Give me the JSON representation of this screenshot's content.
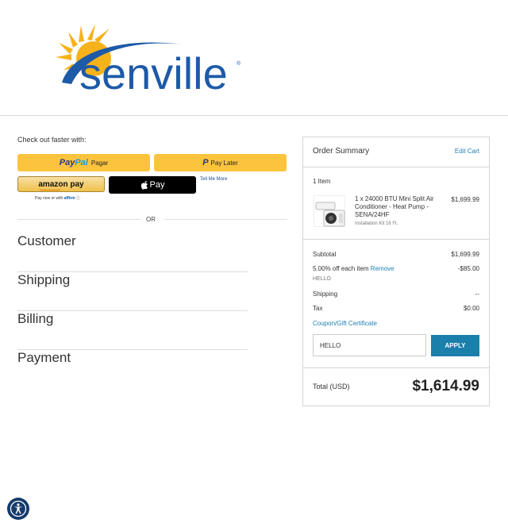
{
  "brand": {
    "logo_text": "senville",
    "logo_mark": "®",
    "colors": {
      "sun": "#f6b21a",
      "wordmark": "#1d5aa8"
    }
  },
  "express": {
    "heading": "Check out faster with:",
    "paypal_brand_a": "Pay",
    "paypal_brand_b": "Pal",
    "paypal_label": "Pagar",
    "paylater_mark": "P",
    "paylater_label": "Pay Later",
    "amazon_label": "amazon pay",
    "apple_label": "Pay",
    "tell_me_more": "Tell Me More",
    "affirm_prefix": "Pay now or with",
    "affirm_brand": "affirm",
    "or_label": "OR"
  },
  "steps": [
    "Customer",
    "Shipping",
    "Billing",
    "Payment"
  ],
  "summary": {
    "title": "Order Summary",
    "edit_cart": "Edit Cart",
    "items_count": "1 Item",
    "product": {
      "name": "1 x 24000 BTU Mini Split Air Conditioner - Heat Pump - SENA/24HF",
      "option": "Installation Kit 16 Ft.",
      "price": "$1,699.99"
    },
    "subtotal_label": "Subtotal",
    "subtotal_value": "$1,699.99",
    "discount_label": "5.00% off each item",
    "discount_remove": "Remove",
    "discount_value": "-$85.00",
    "discount_code": "HELLO",
    "shipping_label": "Shipping",
    "shipping_value": "--",
    "tax_label": "Tax",
    "tax_value": "$0.00",
    "coupon_link": "Coupon/Gift Certificate",
    "coupon_value": "HELLO",
    "apply_label": "APPLY",
    "total_label": "Total (USD)",
    "total_value": "$1,614.99"
  },
  "accent_color": "#1a7fab"
}
